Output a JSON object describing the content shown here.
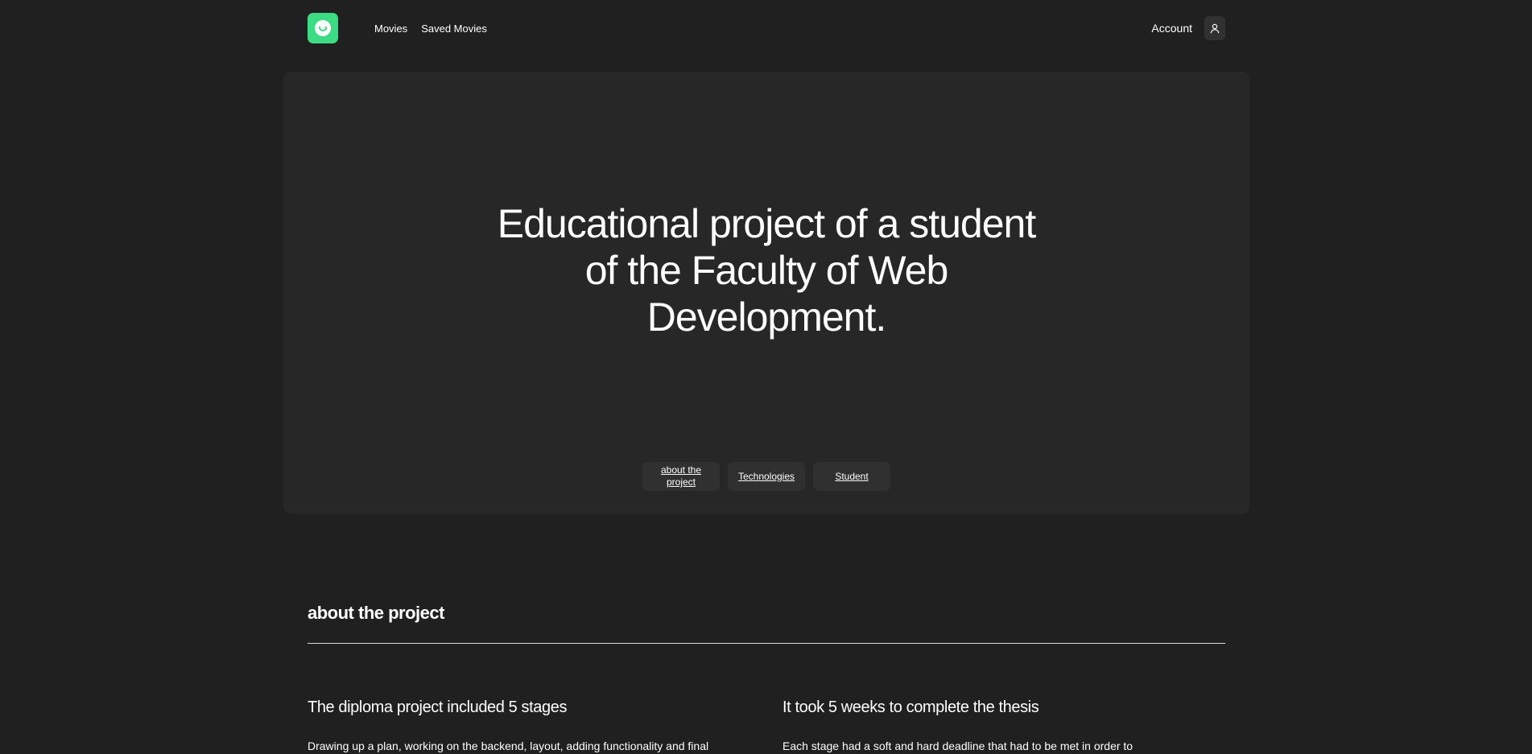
{
  "header": {
    "logo_icon": "smile-logo-icon",
    "nav": [
      {
        "label": "Movies"
      },
      {
        "label": "Saved Movies"
      }
    ],
    "account_label": "Account",
    "account_icon": "user-icon"
  },
  "hero": {
    "title": "Educational project of a student of the Faculty of Web Development.",
    "links": [
      {
        "label": "about the project"
      },
      {
        "label": "Technologies"
      },
      {
        "label": "Student"
      }
    ]
  },
  "about": {
    "title": "about the project",
    "columns": [
      {
        "heading": "The diploma project included 5 stages",
        "text": "Drawing up a plan, working on the backend, layout, adding functionality and final"
      },
      {
        "heading": "It took 5 weeks to complete the thesis",
        "text": "Each stage had a soft and hard deadline that had to be met in order to"
      }
    ]
  },
  "colors": {
    "background": "#202020",
    "hero_background": "#272727",
    "accent": "#3ddc84",
    "chip_background": "#303030"
  }
}
